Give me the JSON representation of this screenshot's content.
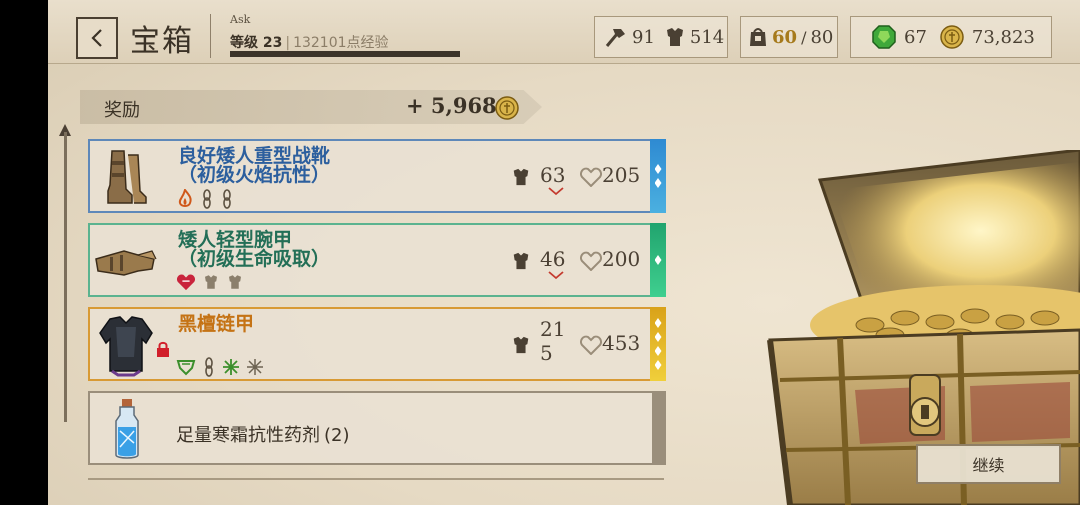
{
  "header": {
    "title": "宝箱",
    "player_name": "Ask",
    "level_label": "等级 23",
    "xp_label": "132101点经验",
    "xp_progress": 1.0
  },
  "stats": {
    "tools": "91",
    "armor": "514",
    "inventory_current": "60",
    "inventory_separator": "/",
    "inventory_max": "80",
    "gems": "67",
    "gold": "73,823"
  },
  "reward": {
    "label": "奖励",
    "value": "+ 5,968"
  },
  "items": [
    {
      "name_line1": "良好矮人重型战靴",
      "name_line2": "（初级火焰抗性）",
      "armor": "63",
      "hp": "205",
      "rarity": "blue",
      "effect_icons": [
        "fire-icon",
        "chain-icon",
        "chain-icon"
      ]
    },
    {
      "name_line1": "矮人轻型腕甲",
      "name_line2": "（初级生命吸取）",
      "armor": "46",
      "hp": "200",
      "rarity": "green",
      "effect_icons": [
        "heart-drain-icon",
        "armor-rune-icon",
        "armor-rune-icon"
      ]
    },
    {
      "name_line1": "黑檀链甲",
      "name_line2": "",
      "armor": "215",
      "hp": "453",
      "rarity": "gold",
      "locked": true,
      "effect_icons": [
        "shield-rune-icon",
        "chain-icon",
        "star-rune-icon",
        "star-rune-icon"
      ]
    },
    {
      "name": "足量寒霜抗性药剂",
      "quantity": "(2)"
    }
  ],
  "continue_button": "继续",
  "colors": {
    "blue_rarity": "#2e8ad2",
    "green_rarity": "#21a46e",
    "gold_rarity": "#d9a219",
    "gold_text": "#a67a1c",
    "gem_green": "#3fa83a"
  }
}
